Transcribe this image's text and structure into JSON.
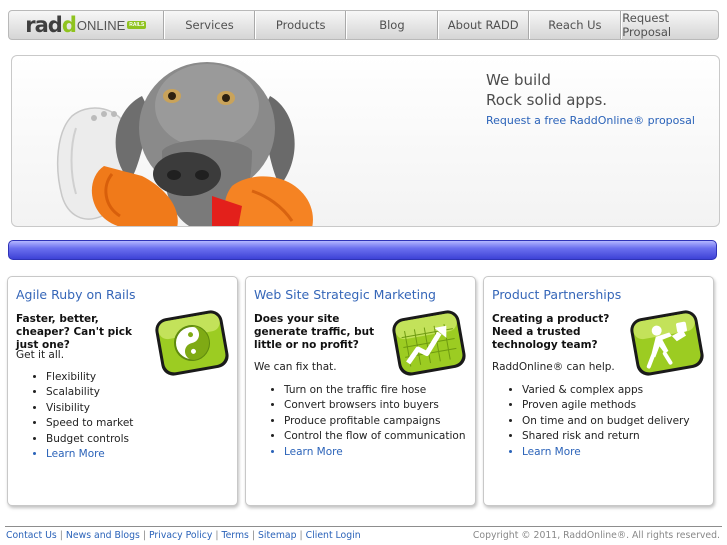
{
  "nav": {
    "logo": {
      "word_dark": "rad",
      "word_green": "d",
      "online": "ONLINE",
      "tag": "RAILS"
    },
    "items": [
      {
        "label": "Services"
      },
      {
        "label": "Products"
      },
      {
        "label": "Blog"
      },
      {
        "label": "About RADD"
      },
      {
        "label": "Reach Us"
      },
      {
        "label": "Request Proposal"
      }
    ]
  },
  "hero": {
    "line1": "We build",
    "line2": "Rock solid apps.",
    "link": "Request a free RaddOnline® proposal",
    "image": "dog-with-chew-toy"
  },
  "cards": [
    {
      "title": "Agile Ruby on Rails",
      "head": "Faster, better, cheaper? Can't pick just one?",
      "intro": "Get it all.",
      "items": [
        "Flexibility",
        "Scalability",
        "Visibility",
        "Speed to market",
        "Budget controls"
      ],
      "link": "Learn More",
      "icon": "yin-yang-icon"
    },
    {
      "title": "Web Site Strategic Marketing",
      "head": "Does your site generate traffic, but little or no profit?",
      "intro": "We can fix that.",
      "items": [
        "Turn on the traffic fire hose",
        "Convert browsers into buyers",
        "Produce profitable campaigns",
        "Control the flow of communication"
      ],
      "link": "Learn More",
      "icon": "growth-chart-icon"
    },
    {
      "title": "Product Partnerships",
      "head": "Creating a product? Need a trusted technology team?",
      "intro": "RaddOnline® can help.",
      "items": [
        "Varied & complex apps",
        "Proven agile methods",
        "On time and on budget delivery",
        "Shared risk and return"
      ],
      "link": "Learn More",
      "icon": "helping-hand-icon"
    }
  ],
  "footer": {
    "links": [
      "Contact Us",
      "News and Blogs",
      "Privacy Policy",
      "Terms",
      "Sitemap",
      "Client Login"
    ],
    "separator": "|",
    "copyright": "Copyright © 2011, RaddOnline®. All rights reserved."
  },
  "colors": {
    "brand_green": "#8fc31f",
    "link_blue": "#2b63b9",
    "title_blue": "#3566b8",
    "bar_blue": "#4b4fe0"
  }
}
